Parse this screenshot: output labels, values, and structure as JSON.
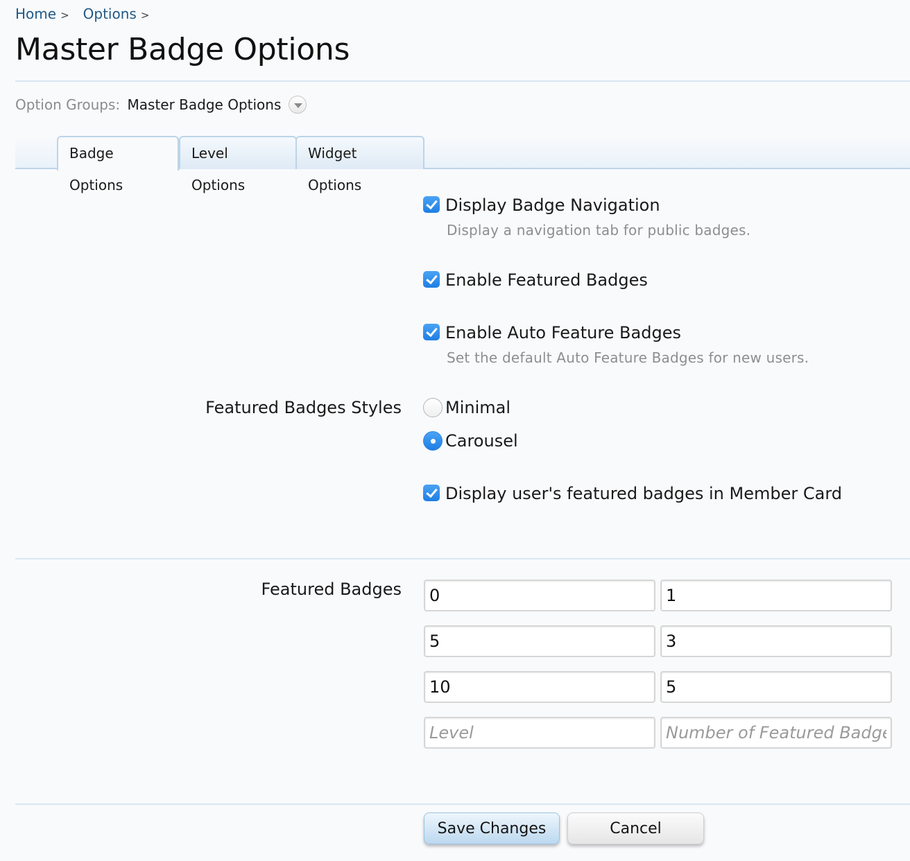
{
  "breadcrumb": [
    {
      "label": "Home",
      "sep": ">"
    },
    {
      "label": "Options",
      "sep": ">"
    }
  ],
  "page_title": "Master Badge Options",
  "option_groups": {
    "label": "Option Groups:",
    "value": "Master Badge Options"
  },
  "tabs": [
    {
      "label": "Badge Options",
      "active": true
    },
    {
      "label": "Level Options",
      "active": false
    },
    {
      "label": "Widget Options",
      "active": false
    }
  ],
  "options": {
    "display_badge_navigation": {
      "label": "Display Badge Navigation",
      "checked": true,
      "explain": "Display a navigation tab for public badges."
    },
    "enable_featured_badges": {
      "label": "Enable Featured Badges",
      "checked": true
    },
    "enable_auto_feature_badges": {
      "label": "Enable Auto Feature Badges",
      "checked": true,
      "explain": "Set the default Auto Feature Badges for new users."
    },
    "featured_badges_styles": {
      "label": "Featured Badges Styles",
      "choices": [
        {
          "label": "Minimal",
          "selected": false
        },
        {
          "label": "Carousel",
          "selected": true
        }
      ]
    },
    "display_in_member_card": {
      "label": "Display user's featured badges in Member Card",
      "checked": true
    }
  },
  "featured_badges": {
    "label": "Featured Badges",
    "rows": [
      {
        "level": "0",
        "count": "1"
      },
      {
        "level": "5",
        "count": "3"
      },
      {
        "level": "10",
        "count": "5"
      }
    ],
    "placeholders": {
      "level": "Level",
      "count": "Number of Featured Badges"
    }
  },
  "buttons": {
    "save": "Save Changes",
    "cancel": "Cancel"
  },
  "colors": {
    "link": "#1f5a87",
    "accent": "#2b86e6",
    "border": "#bcd4e8"
  }
}
